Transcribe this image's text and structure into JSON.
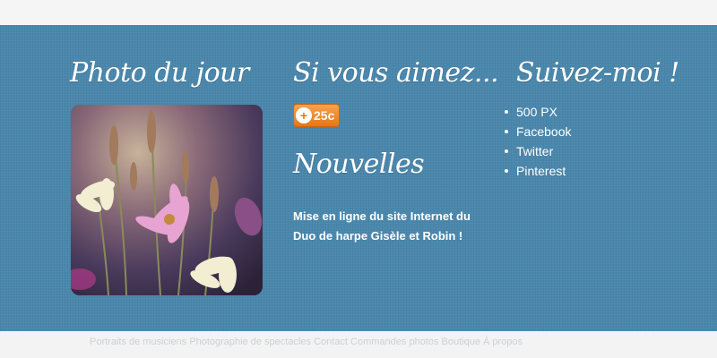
{
  "photo_section": {
    "heading": "Photo du jour",
    "image_alt": "Fleurs sauvages roses et blanches"
  },
  "like_section": {
    "heading": "Si vous aimez...",
    "flattr_count": "25c",
    "flattr_icon": "flattr-plus-icon"
  },
  "news_section": {
    "heading": "Nouvelles",
    "text": "Mise en ligne du site Internet du Duo de harpe Gisèle et Robin !"
  },
  "follow_section": {
    "heading": "Suivez-moi !",
    "links": [
      "500 PX",
      "Facebook",
      "Twitter",
      "Pinterest"
    ]
  },
  "footer": {
    "text": "Portraits de musiciens  Photographie de spectacles  Contact  Commandes photos  Boutique  À propos"
  },
  "colors": {
    "band": "#4a87ac",
    "flattr_orange": "#f39333",
    "text": "#ffffff"
  }
}
